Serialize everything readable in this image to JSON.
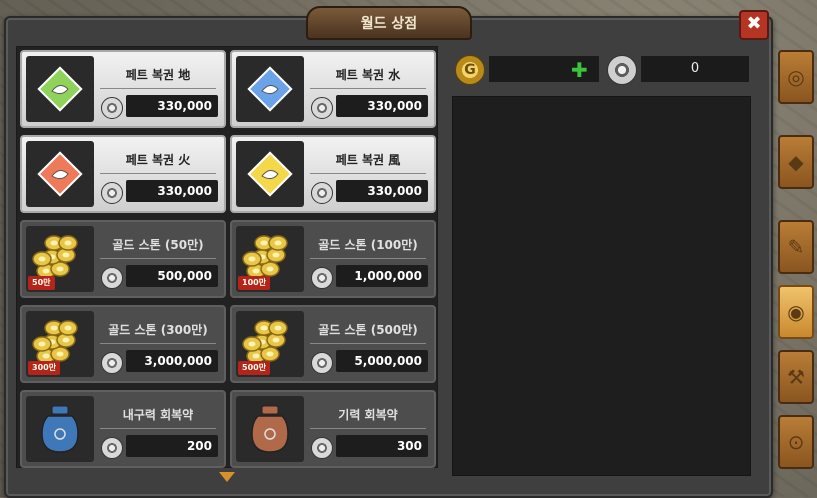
{
  "window": {
    "title": "월드 상점",
    "close_label": "✖"
  },
  "currency": {
    "gold_symbol": "G",
    "gold_value": "",
    "add_symbol": "✚",
    "stone_value": "0"
  },
  "items": [
    {
      "name": "페트 복권 地",
      "price": "330,000",
      "style": "light",
      "thumb": "ticket",
      "color": "#8fd35a"
    },
    {
      "name": "페트 복권 水",
      "price": "330,000",
      "style": "light",
      "thumb": "ticket",
      "color": "#6aa3e8"
    },
    {
      "name": "페트 복권 火",
      "price": "330,000",
      "style": "light",
      "thumb": "ticket",
      "color": "#ee7a5a"
    },
    {
      "name": "페트 복권 風",
      "price": "330,000",
      "style": "light",
      "thumb": "ticket",
      "color": "#f3d84a"
    },
    {
      "name": "골드 스톤 (50만)",
      "price": "500,000",
      "style": "dark",
      "thumb": "coins",
      "banner": "50만"
    },
    {
      "name": "골드 스톤 (100만)",
      "price": "1,000,000",
      "style": "dark",
      "thumb": "coins",
      "banner": "100만"
    },
    {
      "name": "골드 스톤 (300만)",
      "price": "3,000,000",
      "style": "dark",
      "thumb": "coins",
      "banner": "300만"
    },
    {
      "name": "골드 스톤 (500만)",
      "price": "5,000,000",
      "style": "dark",
      "thumb": "coins",
      "banner": "500만"
    },
    {
      "name": "내구력 회복약",
      "price": "200",
      "style": "dark",
      "thumb": "jar-blue",
      "color": "#3f78b8"
    },
    {
      "name": "기력 회복약",
      "price": "300",
      "style": "dark",
      "thumb": "jar-brown",
      "color": "#b06a4a"
    }
  ],
  "side_tabs": [
    {
      "icon": "spiral-icon",
      "glyph": "◎"
    },
    {
      "icon": "gem-icon",
      "glyph": "◆"
    },
    {
      "icon": "scroll-icon",
      "glyph": "✎"
    },
    {
      "icon": "stone-icon",
      "glyph": "◉",
      "active": true
    },
    {
      "icon": "hammer-icon",
      "glyph": "⚒"
    },
    {
      "icon": "compass-icon",
      "glyph": "⊙"
    }
  ]
}
